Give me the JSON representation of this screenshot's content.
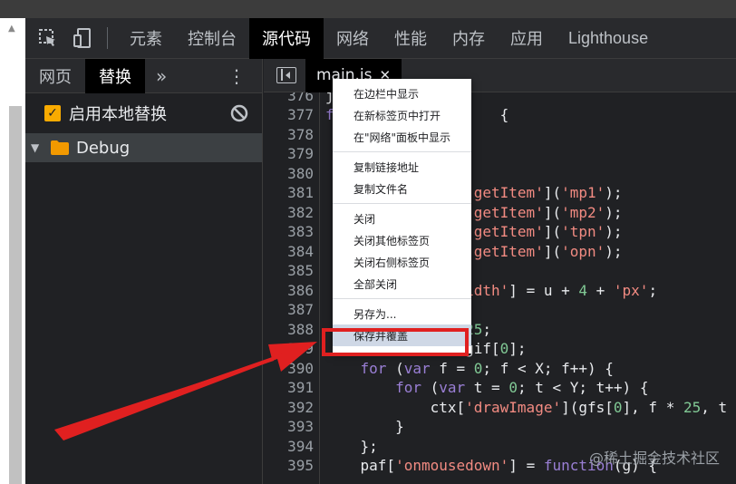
{
  "main_tabs": [
    "元素",
    "控制台",
    "源代码",
    "网络",
    "性能",
    "内存",
    "应用",
    "Lighthouse"
  ],
  "active_main_tab": "源代码",
  "left_panel": {
    "tabs": [
      "网页",
      "替换"
    ],
    "more": "»",
    "menu": "⋮",
    "override_label": "启用本地替换",
    "override_checked": true,
    "folder": "Debug"
  },
  "editor": {
    "file_tab": "main.js",
    "close": "✕",
    "line_numbers": [
      "376",
      "377",
      "378",
      "379",
      "380",
      "381",
      "382",
      "383",
      "384",
      "385",
      "386",
      "387",
      "388",
      "389",
      "390",
      "391",
      "392",
      "393",
      "394",
      "395"
    ]
  },
  "context_menu": {
    "items": [
      "在边栏中显示",
      "在新标签页中打开",
      "在\"网络\"面板中显示",
      "复制链接地址",
      "复制文件名",
      "关闭",
      "关闭其他标签页",
      "关闭右侧标签页",
      "全部关闭",
      "另存为...",
      "保存并覆盖"
    ],
    "highlighted": "保存并覆盖"
  },
  "watermark": "@稀土掘金技术社区",
  "colors": {
    "accent_checkbox": "#f9ab00",
    "highlight_box": "#e02020",
    "folder": "#f29900"
  }
}
